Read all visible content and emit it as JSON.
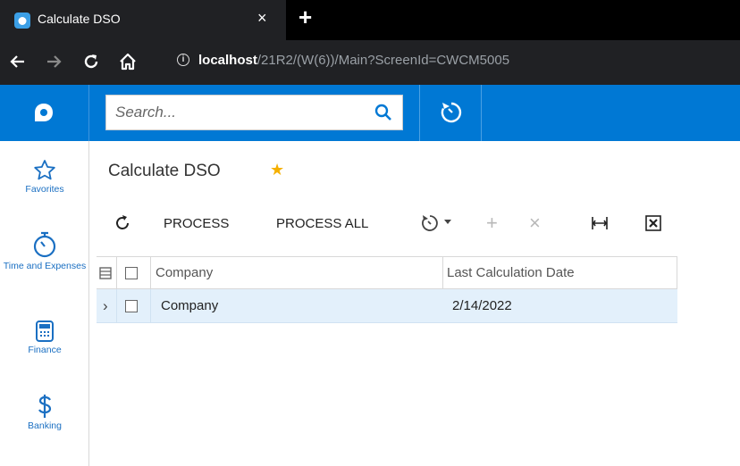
{
  "browser": {
    "tab_title": "Calculate DSO",
    "close_glyph": "×",
    "new_tab_glyph": "+",
    "url_host": "localhost",
    "url_path": "/21R2/(W(6))/Main?ScreenId=CWCM5005",
    "info_glyph": "i"
  },
  "header": {
    "search_placeholder": "Search..."
  },
  "sidebar": {
    "items": [
      {
        "label": "Favorites",
        "icon": "star-outline-icon"
      },
      {
        "label": "Time and Expenses",
        "icon": "stopwatch-icon"
      },
      {
        "label": "Finance",
        "icon": "calculator-icon"
      },
      {
        "label": "Banking",
        "icon": "dollar-icon"
      }
    ]
  },
  "page": {
    "title": "Calculate DSO",
    "star_glyph": "★"
  },
  "toolbar": {
    "process_label": "PROCESS",
    "process_all_label": "PROCESS ALL",
    "add_glyph": "+",
    "delete_glyph": "×"
  },
  "grid": {
    "columns": [
      "Company",
      "Last Calculation Date"
    ],
    "rows": [
      {
        "company": "Company",
        "last_calculation_date": "2/14/2022"
      }
    ],
    "expand_glyph": "›"
  },
  "colors": {
    "accent": "#0078d4",
    "selected_row": "#e3f0fb",
    "star": "#f5b000"
  }
}
